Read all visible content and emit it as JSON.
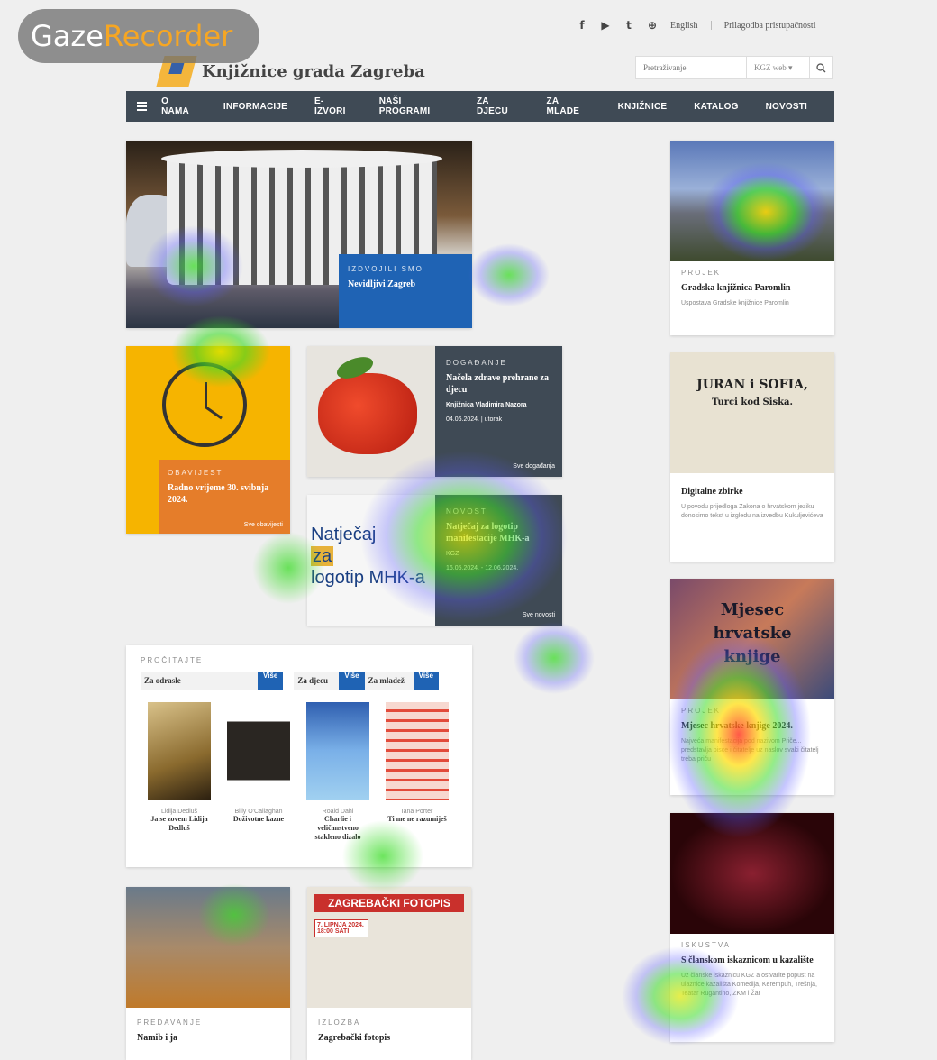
{
  "watermark": {
    "part1": "Gaze",
    "part2": "Recorder"
  },
  "topbar": {
    "facebook": "f",
    "youtube": "▶",
    "twitter": "t",
    "other": "⊕",
    "english": "English",
    "accessibility": "Prilagodba pristupačnosti"
  },
  "logo": {
    "text": "Knjižnice grada Zagreba"
  },
  "search": {
    "placeholder": "Pretraživanje",
    "scope": "KGZ web",
    "arrow": "▾"
  },
  "nav": {
    "items": [
      "O NAMA",
      "INFORMACIJE",
      "E-IZVORI",
      "NAŠI PROGRAMI",
      "ZA DJECU",
      "ZA MLADE",
      "KNJIŽNICE",
      "KATALOG",
      "NOVOSTI"
    ]
  },
  "hero": {
    "kicker": "IZDVOJILI SMO",
    "title": "Nevidljivi Zagreb"
  },
  "notice": {
    "kicker": "OBAVIJEST",
    "title": "Radno vrijeme 30. svibnja 2024.",
    "more": "Sve obavijesti"
  },
  "event": {
    "kicker": "DOGAĐANJE",
    "title": "Načela zdrave prehrane za djecu",
    "library": "Knjižnica Vladimira Nazora",
    "date": "04.06.2024. | utorak",
    "more": "Sve događanja"
  },
  "news": {
    "image_text_1": "Natječaj",
    "image_text_2": "za",
    "image_text_3": "logotip MHK-a",
    "kicker": "NOVOST",
    "title": "Natječaj za logotip manifestacije MHK-a",
    "org": "KGZ",
    "date": "16.05.2024. - 12.06.2024.",
    "more": "Sve novosti"
  },
  "read": {
    "kicker": "PROČITAJTE",
    "tabs": [
      {
        "label": "Za odrasle",
        "btn": "Više"
      },
      {
        "label": "Za djecu",
        "btn": "Više"
      },
      {
        "label": "Za mladež",
        "btn": "Više"
      }
    ],
    "books": [
      {
        "author": "Lidija Dedluš",
        "title": "Ja se zovem Lidija Dedluš"
      },
      {
        "author": "Billy O'Callaghan",
        "title": "Doživotne kazne"
      },
      {
        "author": "Roald Dahl",
        "title": "Charlie i veličanstveno stakleno dizalo"
      },
      {
        "author": "Iana Porter",
        "title": "Ti me ne razumiješ"
      }
    ]
  },
  "right": [
    {
      "kicker": "PROJEKT",
      "title": "Gradska knjižnica Paromlin",
      "desc": "Uspostava Gradske knjižnice Paromlin"
    },
    {
      "kicker": "",
      "title": "Digitalne zbirke",
      "desc": "U povodu prijedloga Zakona o hrvatskom jeziku donosimo tekst u izgledu na izvedbu Kukuljevićeva",
      "poster_1": "JURAN i SOFIA,",
      "poster_2": "Turci kod Siska."
    },
    {
      "kicker": "PROJEKT",
      "title": "Mjesec hrvatske knjige 2024.",
      "desc": "Najveća manifestacija pod nazivom Priče... predstavlja pisce i čitatelje uz naslov svaki čitatelj treba priču",
      "poster_1": "Mjesec",
      "poster_2": "hrvatske",
      "poster_3": "knjige"
    },
    {
      "kicker": "ISKUSTVA",
      "title": "S članskom iskaznicom u kazalište",
      "desc": "Uz članske iskaznicu KGZ a ostvarite popust na ulaznice kazališta Komedija, Kerempuh, Trešnja, Teatar Rugantino, ZKM i Žar"
    }
  ],
  "bottom": [
    {
      "kicker": "PREDAVANJE",
      "title": "Namib i ja"
    },
    {
      "kicker": "IZLOŽBA",
      "title": "Zagrebački fotopis",
      "poster_title": "ZAGREBAČKI FOTOPIS",
      "poster_date": "7. LIPNJA 2024. 18:00 SATI"
    }
  ]
}
